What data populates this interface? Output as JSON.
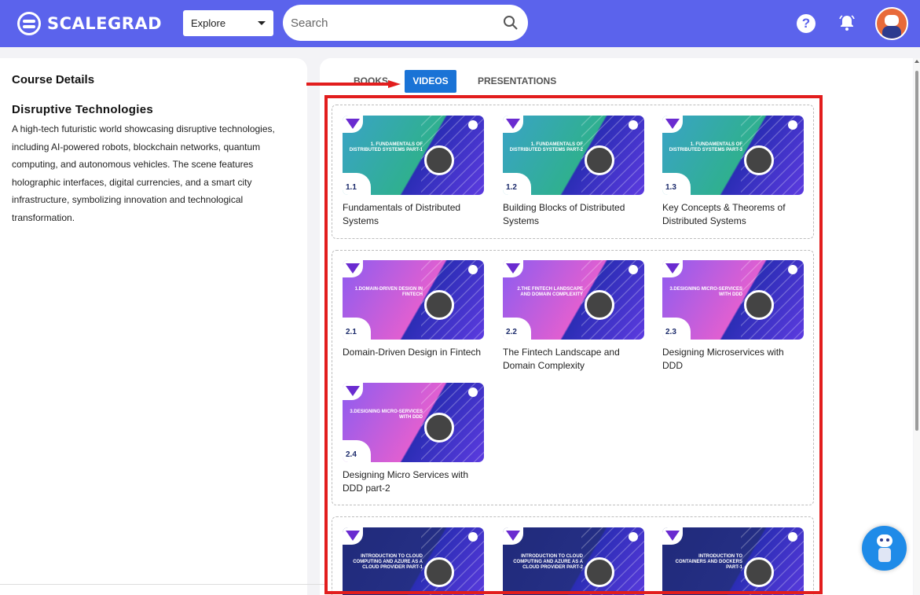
{
  "brand": {
    "name": "SCALEGRAD"
  },
  "header": {
    "explore_label": "Explore",
    "search_placeholder": "Search",
    "help_glyph": "?"
  },
  "course": {
    "section_title": "Course Details",
    "name": "Disruptive Technologies",
    "description": "A high-tech futuristic world showcasing disruptive technologies, including AI-powered robots, blockchain networks, quantum computing, and autonomous vehicles. The scene features holographic interfaces, digital currencies, and a smart city infrastructure, symbolizing innovation and technological transformation."
  },
  "tabs": {
    "books": "BOOKS",
    "videos": "VIDEOS",
    "presentations": "PRESENTATIONS",
    "active": "videos"
  },
  "modules": [
    {
      "theme": "green",
      "videos": [
        {
          "num": "1.1",
          "thumb_title": "1. FUNDAMENTALS OF DISTRIBUTED SYSTEMS PART-1",
          "caption": "Fundamentals of Distributed Systems"
        },
        {
          "num": "1.2",
          "thumb_title": "1. FUNDAMENTALS OF DISTRIBUTED SYSTEMS PART-2",
          "caption": "Building Blocks of Distributed Systems"
        },
        {
          "num": "1.3",
          "thumb_title": "1. FUNDAMENTALS OF DISTRIBUTED SYSTEMS PART-3",
          "caption": "Key Concepts & Theorems of Distributed Systems"
        }
      ]
    },
    {
      "theme": "pink",
      "videos": [
        {
          "num": "2.1",
          "thumb_title": "1.DOMAIN-DRIVEN DESIGN IN FINTECH",
          "caption": "Domain-Driven Design in Fintech"
        },
        {
          "num": "2.2",
          "thumb_title": "2.THE FINTECH LANDSCAPE AND DOMAIN COMPLEXITY",
          "caption": "The Fintech Landscape and Domain Complexity"
        },
        {
          "num": "2.3",
          "thumb_title": "3.DESIGNING MICRO-SERVICES WITH DDD",
          "caption": "Designing Microservices with DDD"
        },
        {
          "num": "2.4",
          "thumb_title": "3.DESIGNING MICRO-SERVICES WITH DDD",
          "caption": "Designing Micro Services with DDD part-2"
        }
      ]
    },
    {
      "theme": "navy",
      "videos": [
        {
          "thumb_title": "INTRODUCTION TO CLOUD COMPUTING AND AZURE AS A CLOUD PROVIDER PART-1"
        },
        {
          "thumb_title": "INTRODUCTION TO CLOUD COMPUTING AND AZURE AS A CLOUD PROVIDER PART-2"
        },
        {
          "thumb_title": "INTRODUCTION TO CONTAINERS AND DOCKERS PART-1"
        }
      ]
    }
  ],
  "colors": {
    "topbar": "#5b63ec",
    "active_tab": "#1a73d6",
    "annotation": "#e21d1d",
    "chat_button": "#1f8be8"
  }
}
